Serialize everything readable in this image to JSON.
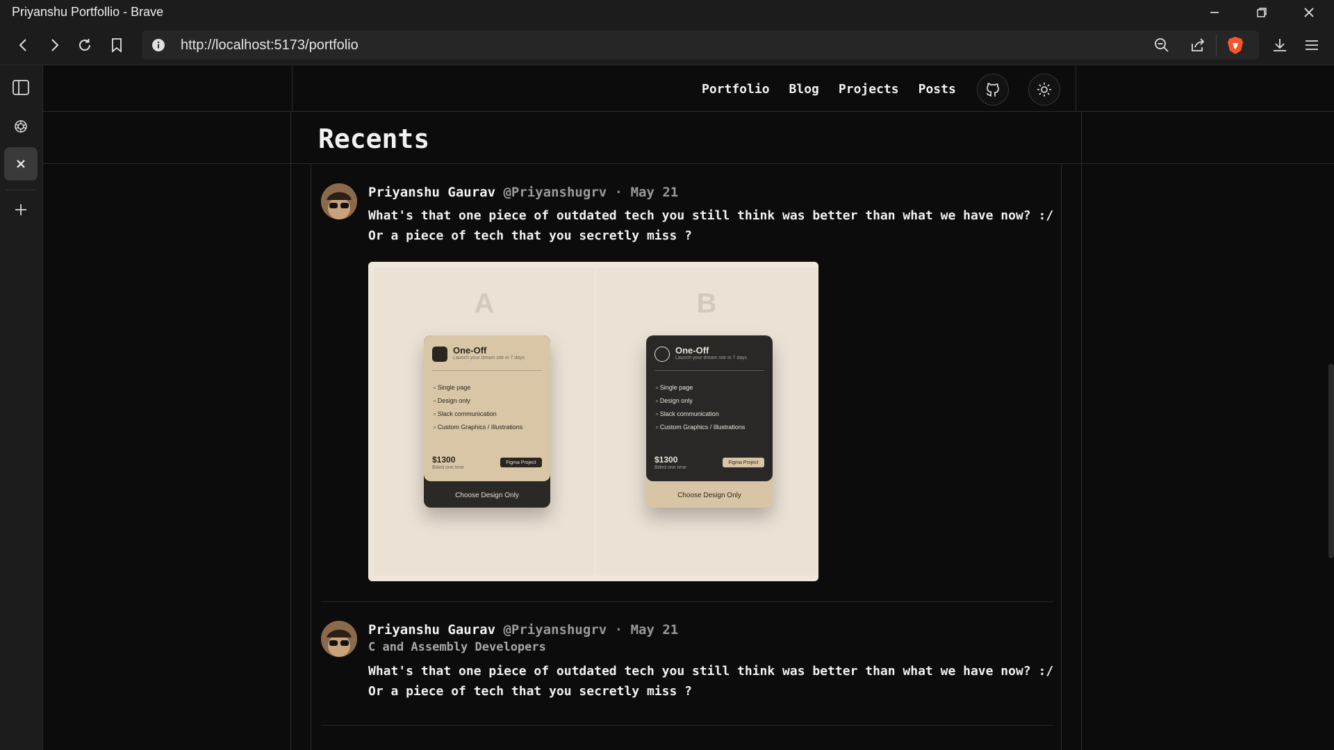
{
  "window": {
    "title": "Priyanshu Portfollio - Brave",
    "controls": [
      "minimize",
      "restore",
      "close"
    ]
  },
  "toolbar": {
    "url": "http://localhost:5173/portfolio",
    "icons": [
      "back-icon",
      "forward-icon",
      "reload-icon",
      "bookmark-icon",
      "info-icon",
      "zoom-icon",
      "share-icon",
      "brave-shield-icon",
      "download-icon",
      "menu-icon"
    ]
  },
  "sidebar": {
    "icons": [
      "sidebar-toggle-icon",
      "chatgpt-icon",
      "close-icon",
      "add-icon"
    ]
  },
  "nav": {
    "items": [
      "Portfolio",
      "Blog",
      "Projects",
      "Posts"
    ],
    "github_icon": "github-icon",
    "theme_icon": "sun-icon"
  },
  "page": {
    "heading": "Recents"
  },
  "posts": [
    {
      "name": "Priyanshu Gaurav",
      "handle": "@Priyanshugrv",
      "separator": "·",
      "date": "May 21",
      "subtitle": "",
      "lines": [
        "What's that one piece of outdated tech you still think was better than what we have now? :/",
        "Or a piece of tech that you secretly miss ?"
      ],
      "image": {
        "panels": [
          {
            "letter": "A",
            "card": {
              "title": "One-Off",
              "subtitle": "Launch your dream site in 7 days",
              "features": [
                "Single page",
                "Design only",
                "Slack communication",
                "Custom Graphics / Illustrations"
              ],
              "price": "$1300",
              "billed": "Billed one time",
              "badge": "Figma Project",
              "cta": "Choose Design Only",
              "top_color": "#d9c6a6",
              "bottom_color": "#2b2926"
            }
          },
          {
            "letter": "B",
            "card": {
              "title": "One-Off",
              "subtitle": "Launch your dream site in 7 days",
              "features": [
                "Single page",
                "Design only",
                "Slack communication",
                "Custom Graphics / Illustrations"
              ],
              "price": "$1300",
              "billed": "Billed one time",
              "badge": "Figma Project",
              "cta": "Choose Design Only",
              "top_color": "#2a2826",
              "bottom_color": "#d8c5a5"
            }
          }
        ]
      }
    },
    {
      "name": "Priyanshu Gaurav",
      "handle": "@Priyanshugrv",
      "separator": "·",
      "date": "May 21",
      "subtitle": "C and Assembly Developers",
      "lines": [
        "What's that one piece of outdated tech you still think was better than what we have now? :/",
        "Or a piece of tech that you secretly miss ?"
      ]
    }
  ],
  "colors": {
    "background": "#0c0c0c",
    "chrome": "#1c1c1c",
    "text": "#f2f2f2",
    "muted": "#9a9a9a",
    "brave_orange": "#fb542b"
  }
}
